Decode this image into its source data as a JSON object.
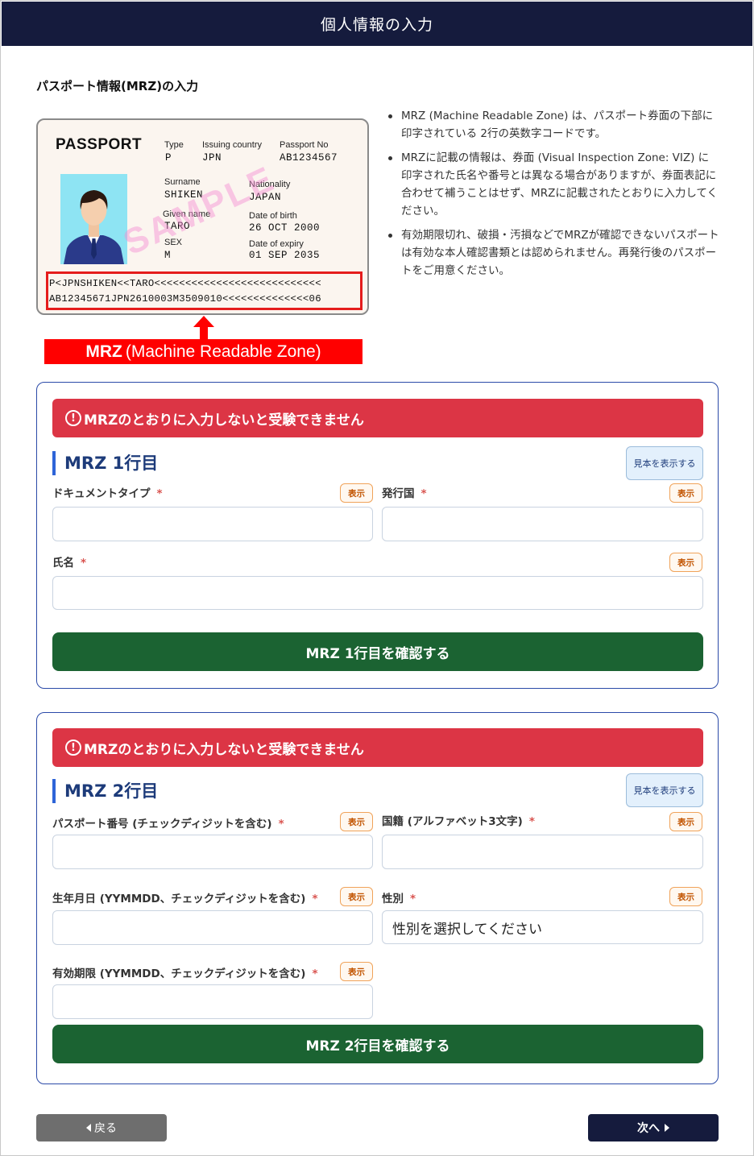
{
  "header": {
    "title": "個人情報の入力"
  },
  "section_title": "パスポート情報(MRZ)の入力",
  "passport_image": {
    "word": "PASSPORT",
    "type_label": "Type",
    "type_value": "P",
    "country_label": "Issuing country",
    "country_value": "JPN",
    "number_label": "Passport No",
    "number_value": "AB1234567",
    "surname_label": "Surname",
    "surname_value": "SHIKEN",
    "nationality_label": "Nationality",
    "nationality_value": "JAPAN",
    "given_label": "Given name",
    "given_value": "TARO",
    "dob_label": "Date of birth",
    "dob_value": "26 OCT 2000",
    "sex_label": "SEX",
    "sex_value": "M",
    "expiry_label": "Date of expiry",
    "expiry_value": "01 SEP 2035",
    "watermark": "SAMPLE",
    "mrz_line1": "P<JPNSHIKEN<<TARO<<<<<<<<<<<<<<<<<<<<<<<<<<<",
    "mrz_line2": "AB12345671JPN2610003M3509010<<<<<<<<<<<<<<06",
    "banner_bold": "MRZ",
    "banner_text": "(Machine Readable Zone)"
  },
  "info": [
    "MRZ (Machine Readable Zone) は、パスポート券面の下部に印字されている 2行の英数字コードです。",
    "MRZに記載の情報は、券面 (Visual Inspection Zone: VIZ) に印字された氏名や番号とは異なる場合がありますが、券面表記に合わせて補うことはせず、MRZに記載されたとおりに入力してください。",
    "有効期限切れ、破損・汚損などでMRZが確認できないパスポートは有効な本人確認書類とは認められません。再発行後のパスポートをご用意ください。"
  ],
  "row1": {
    "alert_icon": "!",
    "alert": "MRZのとおりに入力しないと受験できません",
    "title": "MRZ 1行目",
    "sample_button": "見本を表示する",
    "show_label": "表示",
    "required_mark": "*",
    "doc_type_label": "ドキュメントタイプ",
    "country_label": "発行国",
    "name_label": "氏名",
    "confirm_button": "MRZ 1行目を確認する"
  },
  "row2": {
    "alert_icon": "!",
    "alert": "MRZのとおりに入力しないと受験できません",
    "title": "MRZ 2行目",
    "sample_button": "見本を表示する",
    "show_label": "表示",
    "required_mark": "*",
    "passport_no_label": "パスポート番号 (チェックディジットを含む)",
    "nationality_label": "国籍 (アルファベット3文字)",
    "dob_label": "生年月日 (YYMMDD、チェックディジットを含む)",
    "sex_label": "性別",
    "sex_select_value": "性別を選択してください",
    "expiry_label": "有効期限 (YYMMDD、チェックディジットを含む)",
    "confirm_button": "MRZ 2行目を確認する"
  },
  "nav": {
    "back": "戻る",
    "next": "次へ"
  },
  "colors": {
    "header": "#151b3d",
    "alert": "#dc3545",
    "confirm": "#1b6332",
    "mrz_red": "#ff0000"
  }
}
